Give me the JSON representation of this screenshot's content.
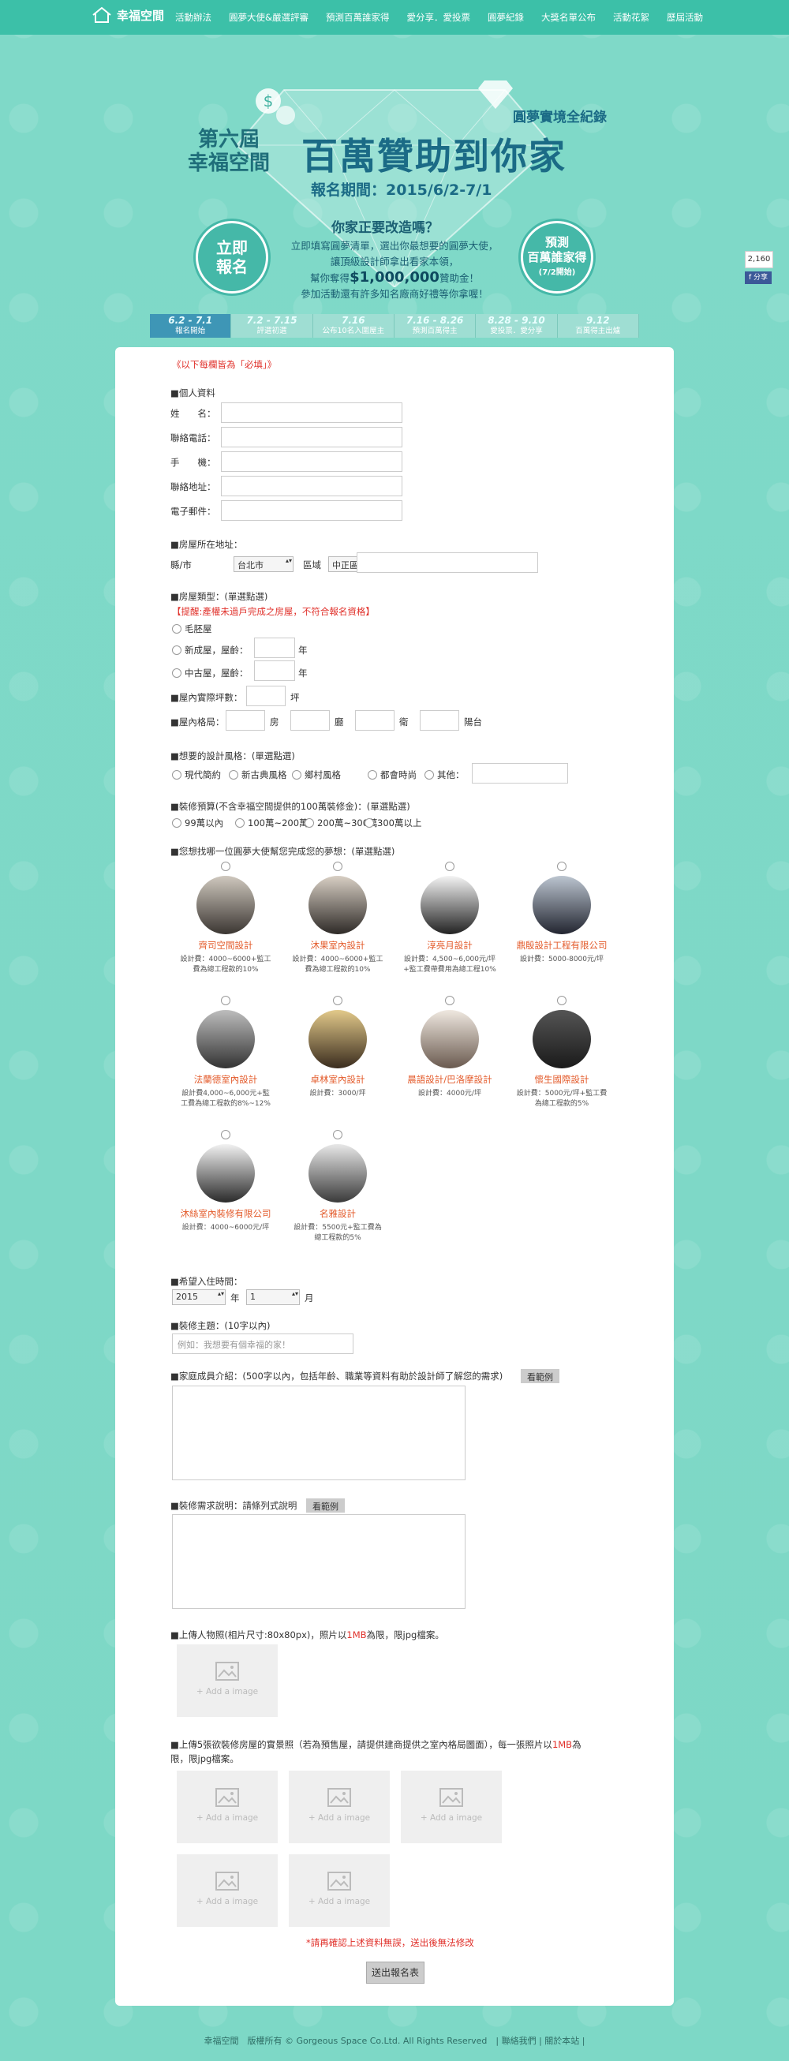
{
  "topbar": {
    "logo_text": "幸福空間",
    "nav": [
      "活動辦法",
      "圓夢大使&嚴選評審",
      "預測百萬誰家得",
      "愛分享．愛投票",
      "圓夢紀錄",
      "大獎名單公布",
      "活動花絮",
      "歷屆活動"
    ]
  },
  "hero": {
    "edition_line1": "第六屆",
    "edition_line2": "幸福空間",
    "headline": "百萬贊助到你家",
    "subtitle": "圓夢實境全紀錄",
    "period": "報名期間：2015/6/2-7/1",
    "question": "你家正要改造嗎？",
    "intro_lines": [
      "立即填寫圓夢清單，選出你最想要的圓夢大使，",
      "讓頂級設計師拿出看家本領，"
    ],
    "intro_money_prefix": "幫你奪得",
    "intro_money": "$1,000,000",
    "intro_money_suffix": "贊助金！",
    "intro_last": "參加活動還有許多知名廠商好禮等你拿喔！",
    "badge_left": [
      "立即",
      "報名"
    ],
    "badge_right": [
      "預測",
      "百萬誰家得",
      "(7/2開始)"
    ]
  },
  "share": {
    "count": "2,160",
    "fb_label": "f 分享"
  },
  "timeline": [
    {
      "date": "6.2 - 7.1",
      "label": "報名開始"
    },
    {
      "date": "7.2 - 7.15",
      "label": "評選初選"
    },
    {
      "date": "7.16",
      "label": "公布10名入圍屋主"
    },
    {
      "date": "7.16 - 8.26",
      "label": "預測百萬得主"
    },
    {
      "date": "8.28 - 9.10",
      "label": "愛投票．愛分享"
    },
    {
      "date": "9.12",
      "label": "百萬得主出爐"
    }
  ],
  "form": {
    "required_note": "《以下每欄皆為「必填」》",
    "personal_title": "■個人資料",
    "fields": [
      "姓　　名：",
      "聯絡電話：",
      "手　　機：",
      "聯絡地址：",
      "電子郵件："
    ],
    "house_addr_title": "■房屋所在地址：",
    "county_label": "縣/市",
    "county_value": "台北市",
    "district_label": "區域",
    "district_value": "中正區",
    "house_type_title": "■房屋類型：(單選點選)",
    "house_type_warn": "【提醒:產權未過戶完成之房屋，不符合報名資格】",
    "house_types": [
      "毛胚屋",
      "新成屋，屋齡：",
      "中古屋，屋齡："
    ],
    "year_unit": "年",
    "area_label": "■屋內實際坪數：",
    "area_unit": "坪",
    "layout_label": "■屋內格局：",
    "layout_units": [
      "房",
      "廳",
      "衛",
      "陽台"
    ],
    "style_title": "■想要的設計風格：(單選點選)",
    "styles": [
      "現代簡約",
      "新古典風格",
      "鄉村風格",
      "都會時尚",
      "其他："
    ],
    "budget_title": "■裝修預算(不含幸福空間提供的100萬裝修金)：(單選點選)",
    "budgets": [
      "99萬以內",
      "100萬~200萬",
      "200萬~300萬",
      "300萬以上"
    ],
    "designer_title": "■您想找哪一位圓夢大使幫您完成您的夢想：(單選點選)",
    "designers": [
      {
        "name": "齊司空間設計",
        "desc": "設計費：4000~6000+監工費為總工程款的10%"
      },
      {
        "name": "沐果室內設計",
        "desc": "設計費：4000~6000+監工費為總工程款的10%"
      },
      {
        "name": "淳亮月設計",
        "desc": "設計費：4,500~6,000元/坪+監工費帶費用為總工程10%"
      },
      {
        "name": "鼎殷設計工程有限公司",
        "desc": "設計費：5000-8000元/坪"
      },
      {
        "name": "法蘭德室內設計",
        "desc": "設計費4,000~6,000元+監工費為總工程款的8%~12%"
      },
      {
        "name": "卓林室內設計",
        "desc": "設計費：3000/坪"
      },
      {
        "name": "晨語設計/巴洛摩設計",
        "desc": "設計費：4000元/坪"
      },
      {
        "name": "懷生國際設計",
        "desc": "設計費：5000元/坪+監工費為總工程款的5%"
      },
      {
        "name": "沐絲室內裝修有限公司",
        "desc": "設計費：4000~6000元/坪"
      },
      {
        "name": "名雅設計",
        "desc": "設計費：5500元+監工費為總工程款的5%"
      }
    ],
    "movein_title": "■希望入住時間：",
    "movein_year": "2015",
    "movein_year_unit": "年",
    "movein_month": "1",
    "movein_month_unit": "月",
    "theme_title": "■裝修主題：(10字以內)",
    "theme_placeholder": "例如：我想要有個幸福的家！",
    "family_title": "■家庭成員介紹：(500字以內，包括年齡、職業等資料有助於設計師了解您的需求)",
    "example_btn": "看範例",
    "needs_title": "■裝修需求說明：請條列式說明",
    "photo_title": "■上傳人物照(相片尺寸:80x80px)，照片以",
    "photo_limit": "1MB",
    "photo_tail": "為限，限jpg檔案。",
    "add_image": "+ Add a image",
    "house_photo_title_a": "■上傳5張欲裝修房屋的實景照（若為預售屋，請提供建商提供之室內格局圖面），每一張照片以",
    "house_photo_limit": "1MB",
    "house_photo_title_b": "為",
    "house_photo_title_c": "限，限jpg檔案。",
    "confirm_note": "*請再確認上述資料無誤，送出後無法修改",
    "submit": "送出報名表"
  },
  "footer": {
    "text": "幸福空間　版權所有 © Gorgeous Space Co.Ltd. All Rights Reserved　| 聯絡我們 | 關於本站 |"
  },
  "colors": {
    "accent": "#3cc0a8",
    "background": "#7fd9c8",
    "red": "#e0302a",
    "designer_name": "#e35a2a"
  }
}
